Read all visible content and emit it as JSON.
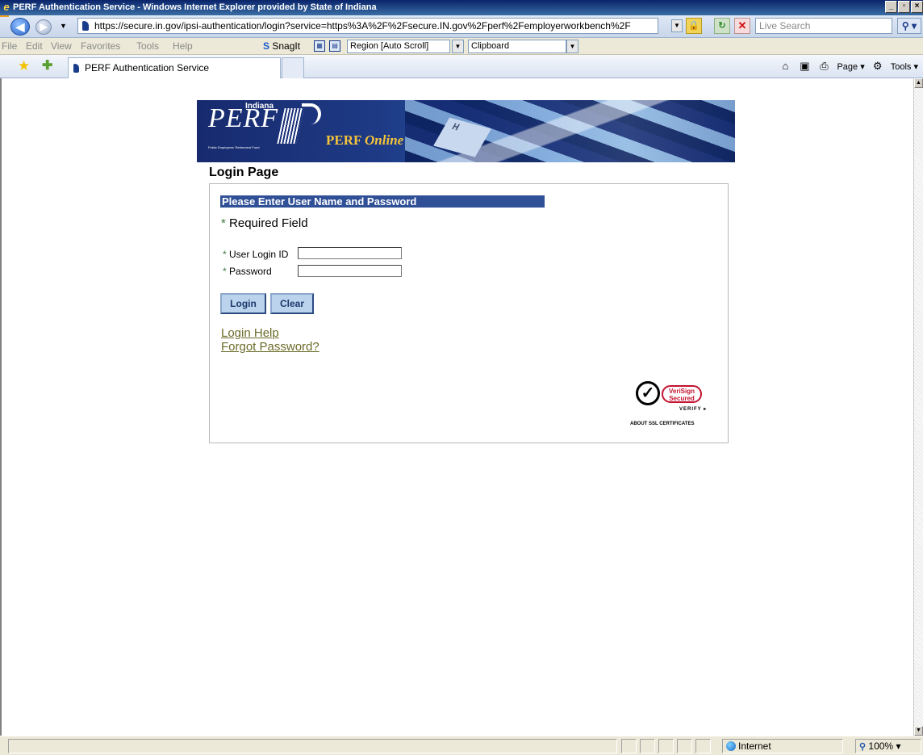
{
  "window": {
    "title": "PERF Authentication Service - Windows Internet Explorer provided by State of Indiana",
    "controls": {
      "minimize": "_",
      "maximize": "▫",
      "close": "×"
    }
  },
  "addressbar": {
    "url": "https://secure.in.gov/ipsi-authentication/login?service=https%3A%2F%2Fsecure.IN.gov%2Fperf%2Femployerworkbench%2F",
    "search_placeholder": "Live Search"
  },
  "menubar": {
    "items": [
      "File",
      "Edit",
      "View",
      "Favorites",
      "Tools",
      "Help"
    ],
    "snagit_label": "SnagIt",
    "capture_mode": "Region [Auto Scroll]",
    "capture_output": "Clipboard"
  },
  "favbar": {
    "tab_title": "PERF Authentication Service",
    "page_label": "Page",
    "tools_label": "Tools"
  },
  "banner": {
    "state": "Indiana",
    "brand": "PERF",
    "tagline": "Public Employees' Retirement Fund",
    "product_brand": "PERF",
    "product_suffix": "Online",
    "key_letter": "H"
  },
  "page": {
    "title": "Login Page",
    "section_header": "Please Enter User Name and Password",
    "required_marker": "*",
    "required_label": "Required Field",
    "fields": [
      {
        "label": "User Login ID",
        "value": ""
      },
      {
        "label": "Password",
        "value": ""
      }
    ],
    "buttons": {
      "login": "Login",
      "clear": "Clear"
    },
    "links": [
      "Login Help",
      "Forgot Password?"
    ]
  },
  "verisign": {
    "badge_line1": "VeriSign",
    "badge_line2": "Secured",
    "verify": "VERIFY ▸",
    "about": "ABOUT SSL CERTIFICATES"
  },
  "statusbar": {
    "zone": "Internet",
    "zoom": "100%"
  }
}
